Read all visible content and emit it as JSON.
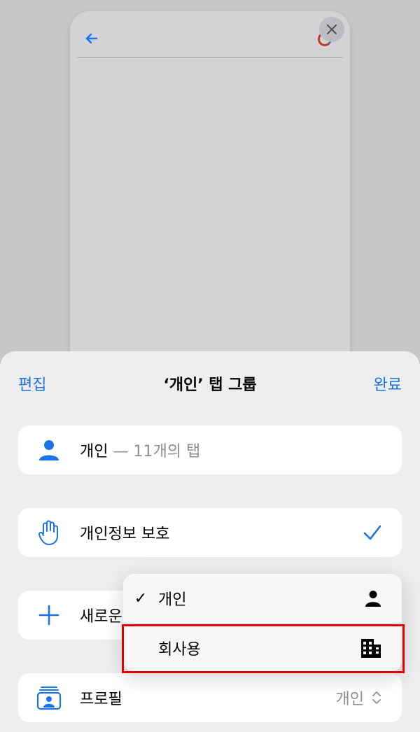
{
  "sheet": {
    "edit_label": "편집",
    "title": "‘개인’ 탭 그룹",
    "done_label": "완료"
  },
  "rows": {
    "group": {
      "name": "개인",
      "count_text": " — 11개의 탭",
      "icon": "person-icon"
    },
    "privacy": {
      "label": "개인정보 보호",
      "icon": "hand-icon",
      "checked": true
    },
    "new_tab": {
      "label": "새로운",
      "icon": "plus-icon"
    },
    "profile": {
      "label": "프로필",
      "value": "개인",
      "icon": "profile-icon"
    }
  },
  "menu": {
    "items": [
      {
        "label": "개인",
        "checked": true,
        "icon": "person-icon"
      },
      {
        "label": "회사용",
        "checked": false,
        "icon": "building-icon"
      }
    ]
  },
  "colors": {
    "accent": "#1a73e8",
    "highlight": "#e00000"
  }
}
